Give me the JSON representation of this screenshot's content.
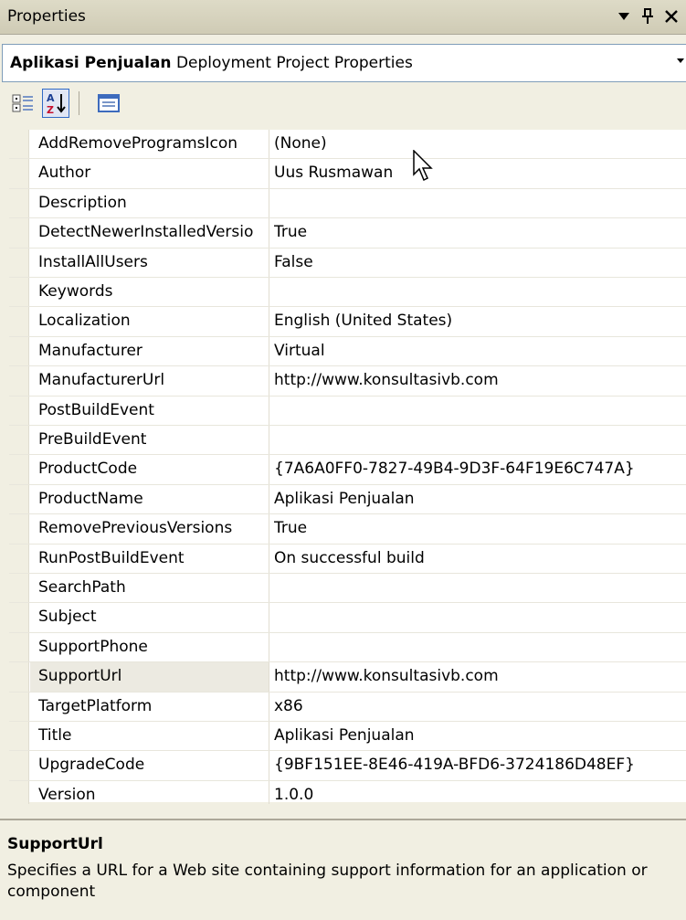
{
  "window": {
    "title": "Properties",
    "controls": [
      "▾",
      "⊥",
      "✕"
    ]
  },
  "object_selector": {
    "object_name": "Aplikasi Penjualan",
    "object_type": "Deployment Project Properties"
  },
  "toolbar": {
    "buttons": [
      {
        "name": "categorized",
        "icon": "categorized-icon"
      },
      {
        "name": "alphabetical",
        "icon": "sort-az-icon",
        "active": true
      },
      {
        "name": "property-pages",
        "icon": "property-pages-icon"
      }
    ]
  },
  "properties": [
    {
      "name": "AddRemoveProgramsIcon",
      "value": "(None)"
    },
    {
      "name": "Author",
      "value": "Uus Rusmawan"
    },
    {
      "name": "Description",
      "value": ""
    },
    {
      "name": "DetectNewerInstalledVersio",
      "value": "True"
    },
    {
      "name": "InstallAllUsers",
      "value": "False"
    },
    {
      "name": "Keywords",
      "value": ""
    },
    {
      "name": "Localization",
      "value": "English (United States)"
    },
    {
      "name": "Manufacturer",
      "value": "Virtual"
    },
    {
      "name": "ManufacturerUrl",
      "value": "http://www.konsultasivb.com"
    },
    {
      "name": "PostBuildEvent",
      "value": ""
    },
    {
      "name": "PreBuildEvent",
      "value": ""
    },
    {
      "name": "ProductCode",
      "value": "{7A6A0FF0-7827-49B4-9D3F-64F19E6C747A}"
    },
    {
      "name": "ProductName",
      "value": "Aplikasi Penjualan"
    },
    {
      "name": "RemovePreviousVersions",
      "value": "True"
    },
    {
      "name": "RunPostBuildEvent",
      "value": "On successful build"
    },
    {
      "name": "SearchPath",
      "value": ""
    },
    {
      "name": "Subject",
      "value": ""
    },
    {
      "name": "SupportPhone",
      "value": ""
    },
    {
      "name": "SupportUrl",
      "value": "http://www.konsultasivb.com",
      "selected": true
    },
    {
      "name": "TargetPlatform",
      "value": "x86"
    },
    {
      "name": "Title",
      "value": "Aplikasi Penjualan"
    },
    {
      "name": "UpgradeCode",
      "value": "{9BF151EE-8E46-419A-BFD6-3724186D48EF}"
    },
    {
      "name": "Version",
      "value": "1.0.0"
    }
  ],
  "description": {
    "title": "SupportUrl",
    "text": "Specifies a URL for a Web site containing support information for an application or component"
  },
  "colors": {
    "panel_bg": "#f1efe2",
    "grid_bg": "#ffffff",
    "selection_border": "#316ac5"
  }
}
